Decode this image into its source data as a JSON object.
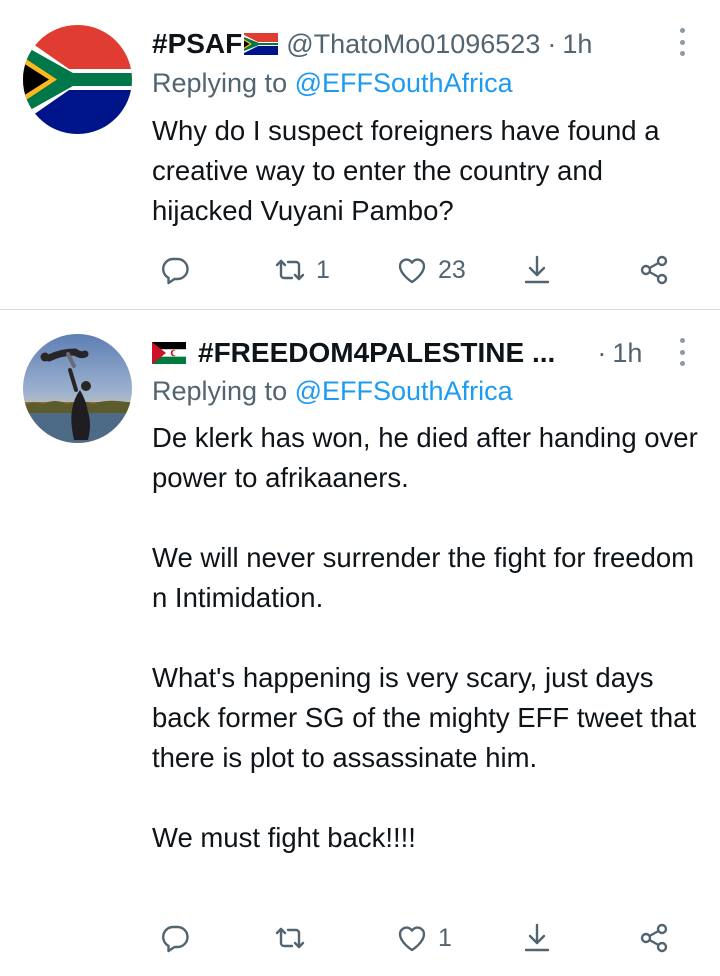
{
  "tweets": [
    {
      "display_name": "#PSAF",
      "handle": "@ThatoMo01096523",
      "separator": "·",
      "time": "1h",
      "replying_label": "Replying to",
      "replying_to": "@EFFSouthAfrica",
      "paragraphs": [
        "Why do I suspect foreigners have found a creative way to enter the country and hijacked Vuyani Pambo?"
      ],
      "retweets": "1",
      "likes": "23"
    },
    {
      "display_name": "#FREEDOM4PALESTINE ...",
      "separator": "·",
      "time": "1h",
      "replying_label": "Replying to",
      "replying_to": "@EFFSouthAfrica",
      "paragraphs": [
        "De klerk has won, he died after handing over power to afrikaaners.",
        "We will never surrender the fight for freedom n Intimidation.",
        "What's happening is very scary, just days back former SG of the mighty EFF tweet that there is plot to assassinate him.",
        "We must fight back!!!!"
      ],
      "likes": "1"
    }
  ],
  "colors": {
    "text": "#0f1419",
    "secondary": "#536471",
    "link": "#1d9bf0",
    "divider": "#d6dbdf"
  },
  "icons": [
    "reply-icon",
    "retweet-icon",
    "like-icon",
    "share-icon",
    "network-share-icon",
    "more-icon",
    "south-africa-flag-icon",
    "western-sahara-flag-icon"
  ]
}
